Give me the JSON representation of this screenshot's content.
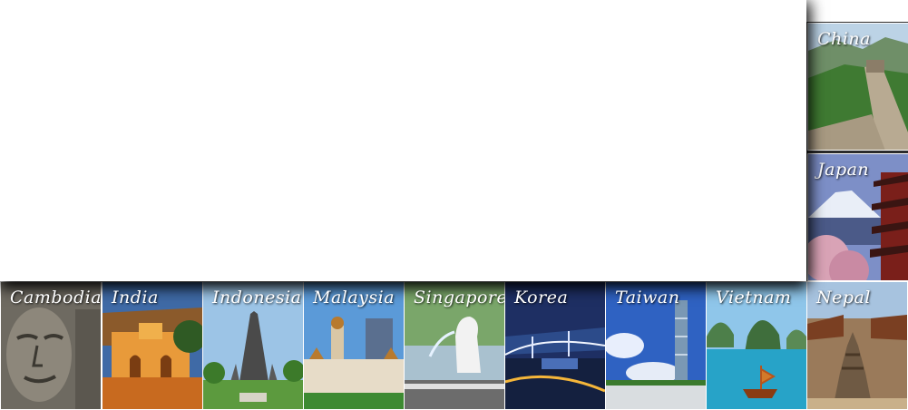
{
  "destinations_top": [
    {
      "name": "China"
    },
    {
      "name": "Japan"
    }
  ],
  "destinations_bottom": [
    {
      "name": "Cambodia"
    },
    {
      "name": "India"
    },
    {
      "name": "Indonesia"
    },
    {
      "name": "Malaysia"
    },
    {
      "name": "Singapore"
    },
    {
      "name": "Korea"
    },
    {
      "name": "Taiwan"
    },
    {
      "name": "Vietnam"
    },
    {
      "name": "Nepal"
    }
  ]
}
